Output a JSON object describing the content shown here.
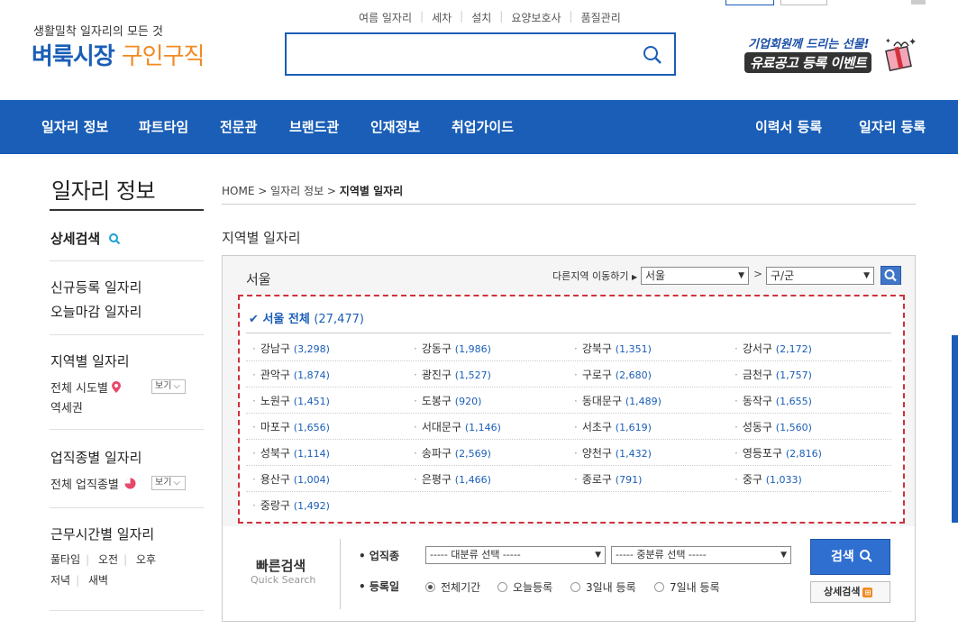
{
  "top_bar": {
    "btn1": "",
    "btn2": "",
    "text": ""
  },
  "header": {
    "logo_sub": "생활밀착 일자리의 모든 것",
    "logo_main": "벼룩시장",
    "logo_orange": "구인구직",
    "quick_links": [
      "여름 일자리",
      "세차",
      "설치",
      "요양보호사",
      "품질관리"
    ],
    "search_placeholder": "",
    "promo_line1": "기업회원께 드리는 선물!",
    "promo_line2": "유료공고 등록 이벤트"
  },
  "nav": {
    "left": [
      "일자리 정보",
      "파트타임",
      "전문관",
      "브랜드관",
      "인재정보",
      "취업가이드"
    ],
    "right": [
      "이력서 등록",
      "일자리 등록"
    ]
  },
  "sidebar": {
    "title": "일자리 정보",
    "detail_search": "상세검색",
    "new_jobs": "신규등록 일자리",
    "closing_jobs": "오늘마감 일자리",
    "region_title": "지역별 일자리",
    "region_all": "전체 시도별",
    "view_label": "보기",
    "station": "역세권",
    "occupation_title": "업직종별 일자리",
    "occupation_all": "전체 업직종별",
    "worktime_title": "근무시간별 일자리",
    "worktime_links": [
      "풀타임",
      "오전",
      "오후"
    ],
    "worktime_links2": [
      "저녁",
      "새벽"
    ]
  },
  "breadcrumb": {
    "home": "HOME",
    "parent": "일자리 정보",
    "current": "지역별 일자리"
  },
  "section_title": "지역별 일자리",
  "region_box": {
    "region_name": "서울",
    "move_label": "다른지역 이동하기",
    "select_city": "서울",
    "select_district": "구/군",
    "all_label": "서울 전체",
    "all_count": "(27,477)"
  },
  "districts": [
    {
      "name": "강남구",
      "count": "(3,298)"
    },
    {
      "name": "강동구",
      "count": "(1,986)"
    },
    {
      "name": "강북구",
      "count": "(1,351)"
    },
    {
      "name": "강서구",
      "count": "(2,172)"
    },
    {
      "name": "관악구",
      "count": "(1,874)"
    },
    {
      "name": "광진구",
      "count": "(1,527)"
    },
    {
      "name": "구로구",
      "count": "(2,680)"
    },
    {
      "name": "금천구",
      "count": "(1,757)"
    },
    {
      "name": "노원구",
      "count": "(1,451)"
    },
    {
      "name": "도봉구",
      "count": "(920)"
    },
    {
      "name": "동대문구",
      "count": "(1,489)"
    },
    {
      "name": "동작구",
      "count": "(1,655)"
    },
    {
      "name": "마포구",
      "count": "(1,656)"
    },
    {
      "name": "서대문구",
      "count": "(1,146)"
    },
    {
      "name": "서초구",
      "count": "(1,619)"
    },
    {
      "name": "성동구",
      "count": "(1,560)"
    },
    {
      "name": "성북구",
      "count": "(1,114)"
    },
    {
      "name": "송파구",
      "count": "(2,569)"
    },
    {
      "name": "양천구",
      "count": "(1,432)"
    },
    {
      "name": "영등포구",
      "count": "(2,816)"
    },
    {
      "name": "용산구",
      "count": "(1,004)"
    },
    {
      "name": "은평구",
      "count": "(1,466)"
    },
    {
      "name": "종로구",
      "count": "(791)"
    },
    {
      "name": "중구",
      "count": "(1,033)"
    },
    {
      "name": "중랑구",
      "count": "(1,492)"
    }
  ],
  "quick_search": {
    "title": "빠른검색",
    "subtitle": "Quick Search",
    "occupation_label": "업직종",
    "major_select": "----- 대분류 선택 -----",
    "minor_select": "----- 중분류 선택 -----",
    "date_label": "등록일",
    "date_options": [
      "전체기간",
      "오늘등록",
      "3일내 등록",
      "7일내 등록"
    ],
    "search_button": "검색",
    "detail_button": "상세검색",
    "detail_badge": "⊞"
  },
  "colors": {
    "brand_blue": "#1a5eb7",
    "accent_orange": "#f18a21",
    "highlight_red": "#d0313c"
  }
}
